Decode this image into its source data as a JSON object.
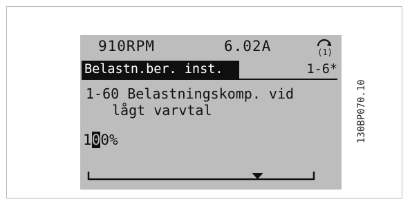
{
  "status": {
    "speed": "910RPM",
    "current": "6.02A",
    "menu_icon": "setup-menu-icon",
    "menu_icon_number": "(1)"
  },
  "header": {
    "title": "Belastn.ber. inst.",
    "code": "1-6*"
  },
  "parameter": {
    "line1": "1-60 Belastningskomp. vid",
    "line2": "lågt varvtal"
  },
  "value": {
    "before_cursor": "1",
    "cursor_digit": "0",
    "after_cursor": "0%"
  },
  "side_label": "130BP070.10",
  "scale": {
    "level_percent": 75
  },
  "colors": {
    "lcd_background": "#bdbdbd",
    "lcd_text": "#111111",
    "highlight": "#0f0f0f"
  }
}
